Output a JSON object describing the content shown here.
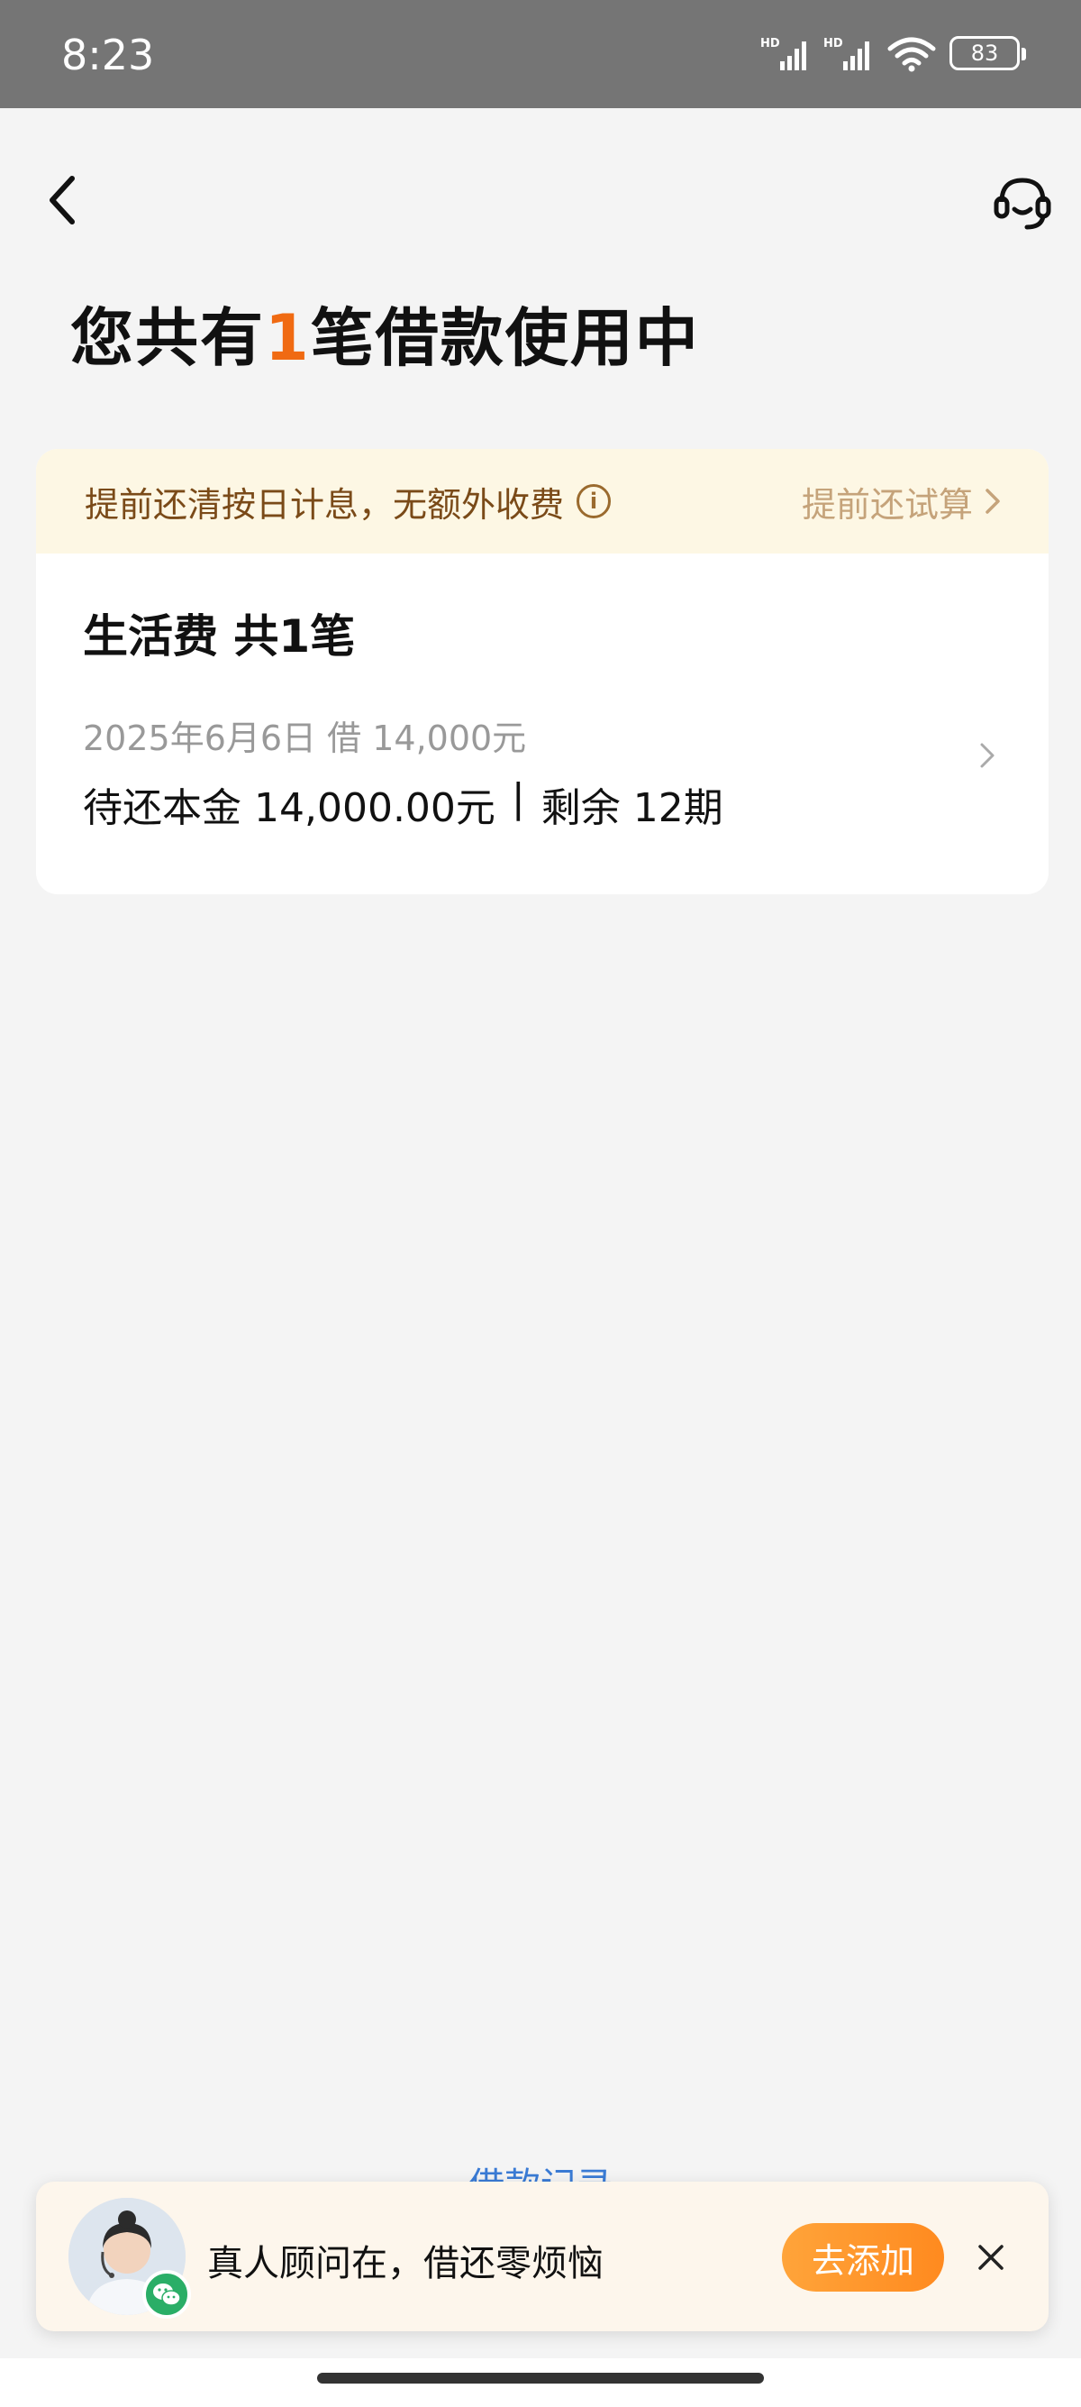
{
  "status_bar": {
    "time": "8:23",
    "battery": "83",
    "icons": [
      "hd-signal-icon",
      "hd-signal-icon",
      "wifi-icon",
      "battery-icon"
    ]
  },
  "nav": {
    "back_icon": "chevron-left-icon",
    "service_icon": "headset-icon"
  },
  "header": {
    "title_prefix": "您共有",
    "loan_count": "1",
    "title_suffix": "笔借款使用中"
  },
  "notice": {
    "text": "提前还清按日计息，无额外收费",
    "action_label": "提前还试算"
  },
  "loan_group": {
    "title": "生活费 共1笔",
    "loans": [
      {
        "date_amount": "2025年6月6日 借 14,000元",
        "principal": "待还本金 14,000.00元",
        "separator": "|",
        "remaining": "剩余 12期"
      }
    ]
  },
  "history_link": "借款记录",
  "advisor_banner": {
    "text": "真人顾问在，借还零烦恼",
    "add_label": "去添加"
  },
  "colors": {
    "accent_orange": "#f06a12",
    "notice_bg": "#fdf7e4",
    "link_blue": "#3a7bd5",
    "button_orange": "#ff8a1f",
    "wechat_green": "#2aae67"
  }
}
